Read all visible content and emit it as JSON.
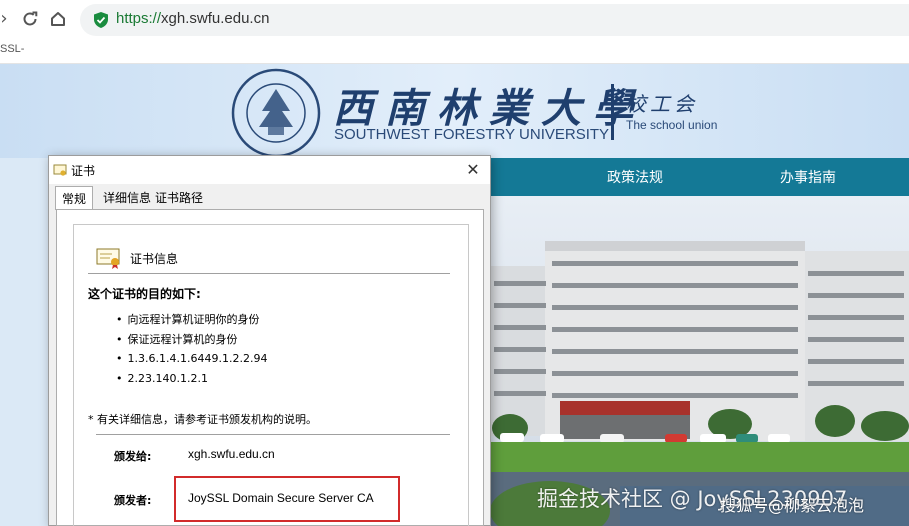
{
  "browser": {
    "url_scheme": "https://",
    "url_host": "xgh.swfu.edu.cn",
    "tab_title_fragment": "SSL-"
  },
  "site": {
    "uni_name_cn": "西南林業大學",
    "uni_name_en": "SOUTHWEST FORESTRY UNIVERSITY",
    "union_cn": "校工会",
    "union_en": "The school union",
    "nav": [
      "政策法规",
      "办事指南"
    ]
  },
  "dialog": {
    "title": "证书",
    "tabs": [
      "常规",
      "详细信息",
      "证书路径"
    ],
    "cert_info_title": "证书信息",
    "purpose_heading": "这个证书的目的如下:",
    "purposes": [
      "向远程计算机证明你的身份",
      "保证远程计算机的身份",
      "1.3.6.1.4.1.6449.1.2.2.94",
      "2.23.140.1.2.1"
    ],
    "note": "* 有关详细信息，请参考证书颁发机构的说明。",
    "issued_to_label": "颁发给:",
    "issued_to": "xgh.swfu.edu.cn",
    "issued_by_label": "颁发者:",
    "issued_by": "JoySSL Domain Secure Server CA"
  },
  "watermarks": {
    "left": "掘金技术社区 @ JoySSL230907",
    "right": "搜狐号@柳絮云泡泡"
  },
  "colors": {
    "url_green": "#1a7a34",
    "nav_teal": "#147996",
    "highlight_red": "#d22b2b"
  }
}
